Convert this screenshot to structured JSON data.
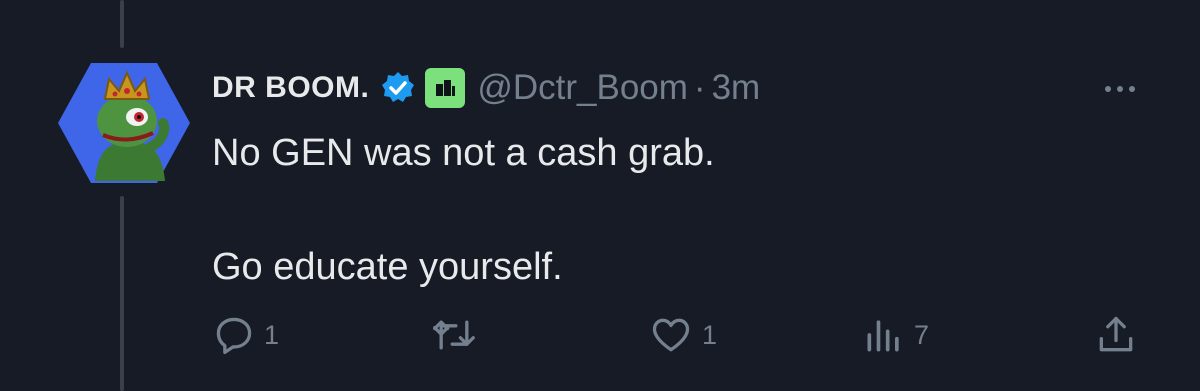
{
  "tweet": {
    "display_name": "DR BOOM.",
    "handle": "@Dctr_Boom",
    "separator": "·",
    "time": "3m",
    "text": "No GEN was not a cash grab.\n\nGo educate yourself.",
    "verified_icon": "verified-badge-icon",
    "affiliate_icon": "affiliate-badge-icon",
    "avatar_icon": "frog-king-avatar"
  },
  "actions": {
    "reply_count": "1",
    "retweet_count": "",
    "like_count": "1",
    "views_count": "7"
  },
  "colors": {
    "background": "#161b25",
    "text": "#e7e9ea",
    "muted": "#74808e",
    "verified": "#1d9bf0",
    "affiliate": "#7ce17c",
    "avatar_bg": "#3f65e8"
  }
}
